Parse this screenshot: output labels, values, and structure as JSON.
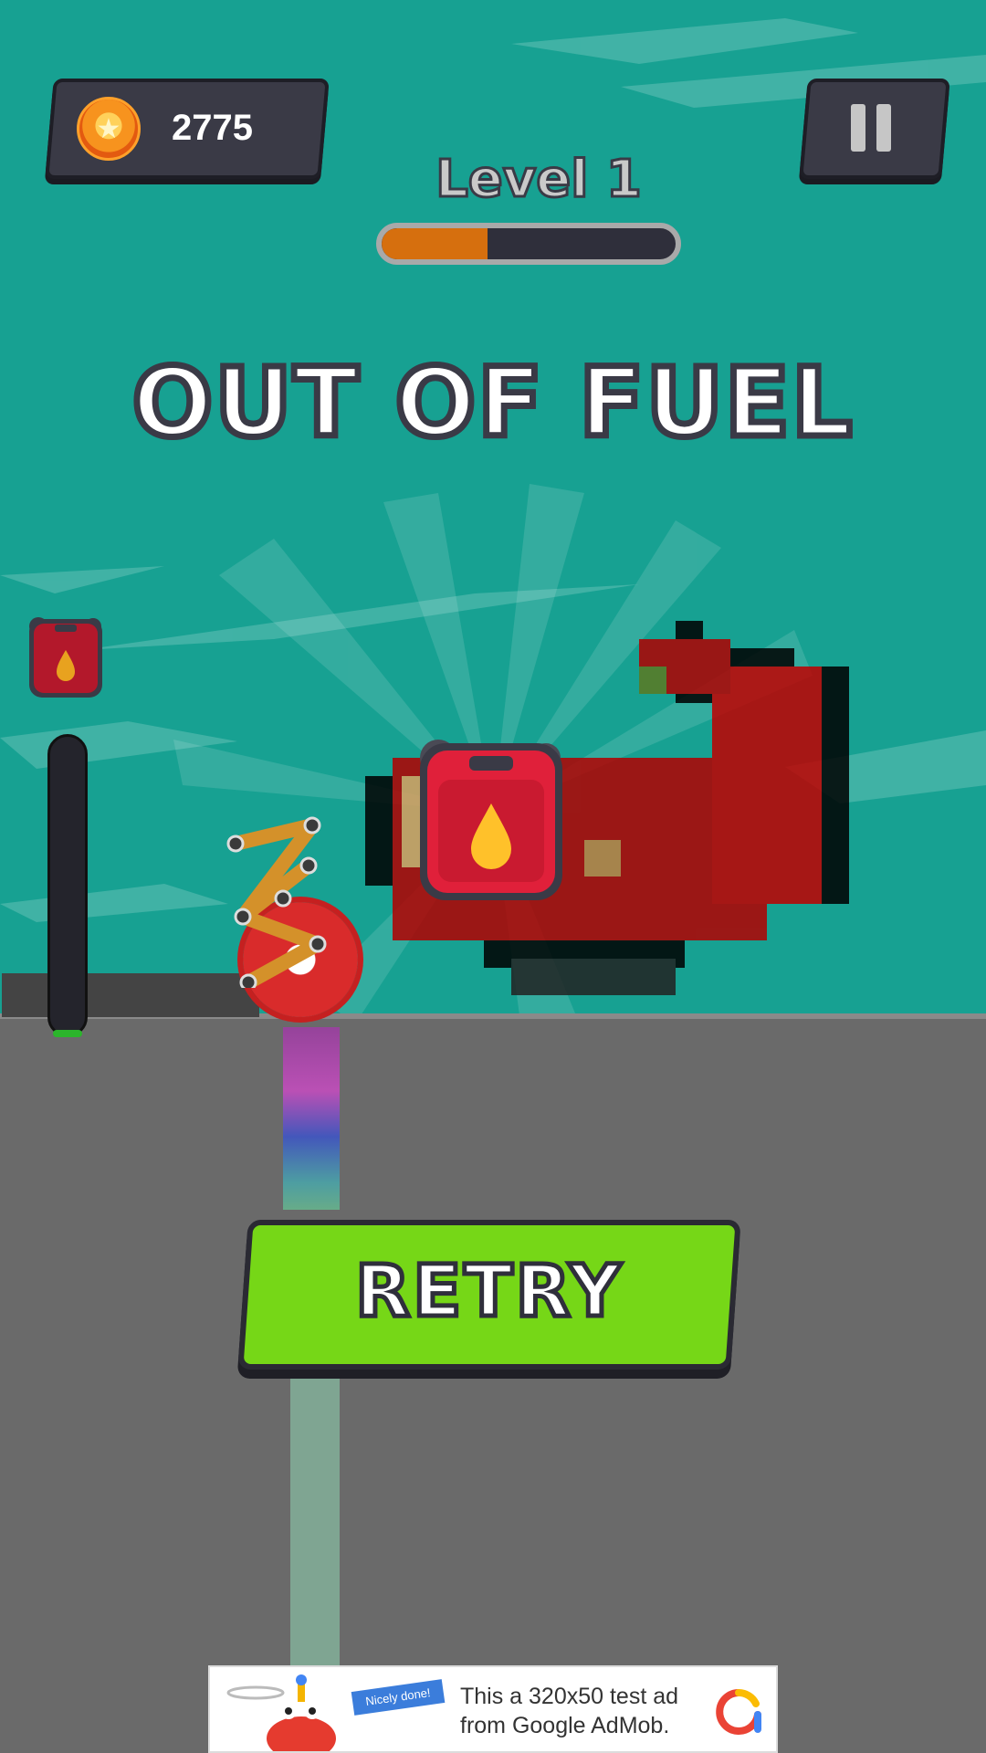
{
  "hud": {
    "coins": "2775",
    "coin_icon": "coin-star-icon",
    "pause_icon": "pause-icon",
    "level_label": "Level 1",
    "level_progress": 0.36
  },
  "status": {
    "headline": "OUT OF FUEL",
    "fuel_icon": "fuel-can-icon",
    "fuel_level": 0.0
  },
  "actions": {
    "retry_label": "RETRY"
  },
  "ad": {
    "badge": "Nicely done!",
    "text": "This a 320x50 test ad from Google AdMob."
  },
  "colors": {
    "sky": "#17a192",
    "ground": "#6a6a6a",
    "retry_button": "#76d717",
    "progress_fill": "#d66f0e",
    "fuel_can": "#e0203a"
  }
}
